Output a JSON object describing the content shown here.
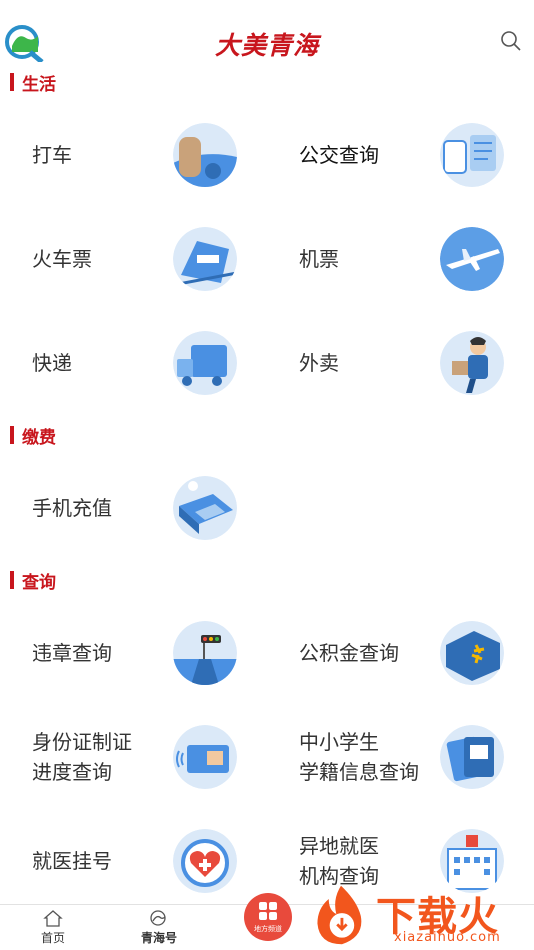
{
  "header": {
    "brand": "大美青海"
  },
  "sections": {
    "life": "生活",
    "pay": "缴费",
    "query": "查询"
  },
  "items": {
    "taxi": "打车",
    "bus": "公交查询",
    "train": "火车票",
    "flight": "机票",
    "express": "快递",
    "takeout": "外卖",
    "phone": "手机充值",
    "traffic": "违章查询",
    "fund": "公积金查询",
    "idcard": "身份证制证\n进度查询",
    "student": "中小学生\n学籍信息查询",
    "doctor": "就医挂号",
    "remote": "异地就医\n机构查询"
  },
  "tabbar": {
    "home": "首页",
    "qinghai": "青海号",
    "center": "地方频道"
  },
  "watermark": {
    "text": "下载火",
    "url": "xiazaihuo.com"
  },
  "colors": {
    "accent": "#c8161d",
    "icon_bg": "#dbe9f8",
    "icon_blue": "#4a90e2"
  }
}
